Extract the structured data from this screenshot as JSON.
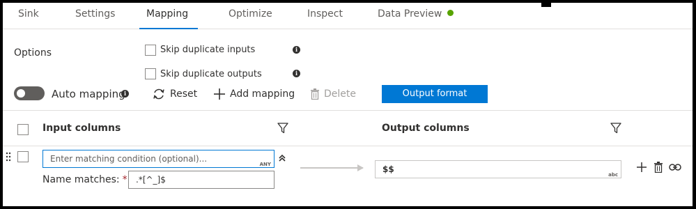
{
  "tabs": [
    {
      "label": "Sink"
    },
    {
      "label": "Settings"
    },
    {
      "label": "Mapping",
      "active": true
    },
    {
      "label": "Optimize"
    },
    {
      "label": "Inspect"
    },
    {
      "label": "Data Preview",
      "status_color": "#57a300"
    }
  ],
  "options": {
    "label": "Options",
    "skip_duplicate_inputs": {
      "label": "Skip duplicate inputs",
      "checked": false
    },
    "skip_duplicate_outputs": {
      "label": "Skip duplicate outputs",
      "checked": false
    }
  },
  "toolbar": {
    "auto_mapping_label": "Auto mapping",
    "auto_mapping_on": true,
    "reset_label": "Reset",
    "add_mapping_label": "Add mapping",
    "delete_label": "Delete",
    "output_format_label": "Output format"
  },
  "table": {
    "input_header": "Input columns",
    "output_header": "Output columns"
  },
  "mapping_row": {
    "condition_placeholder": "Enter matching condition (optional)...",
    "condition_type": "ANY",
    "name_matches_label": "Name matches:",
    "required_mark": "*",
    "name_matches_value": ".*[^_]$",
    "output_value": "$$",
    "output_type": "abc"
  },
  "colors": {
    "accent": "#0078d4",
    "status_green": "#57a300",
    "required_red": "#a4262c",
    "toggle_bg": "#605e5c"
  }
}
